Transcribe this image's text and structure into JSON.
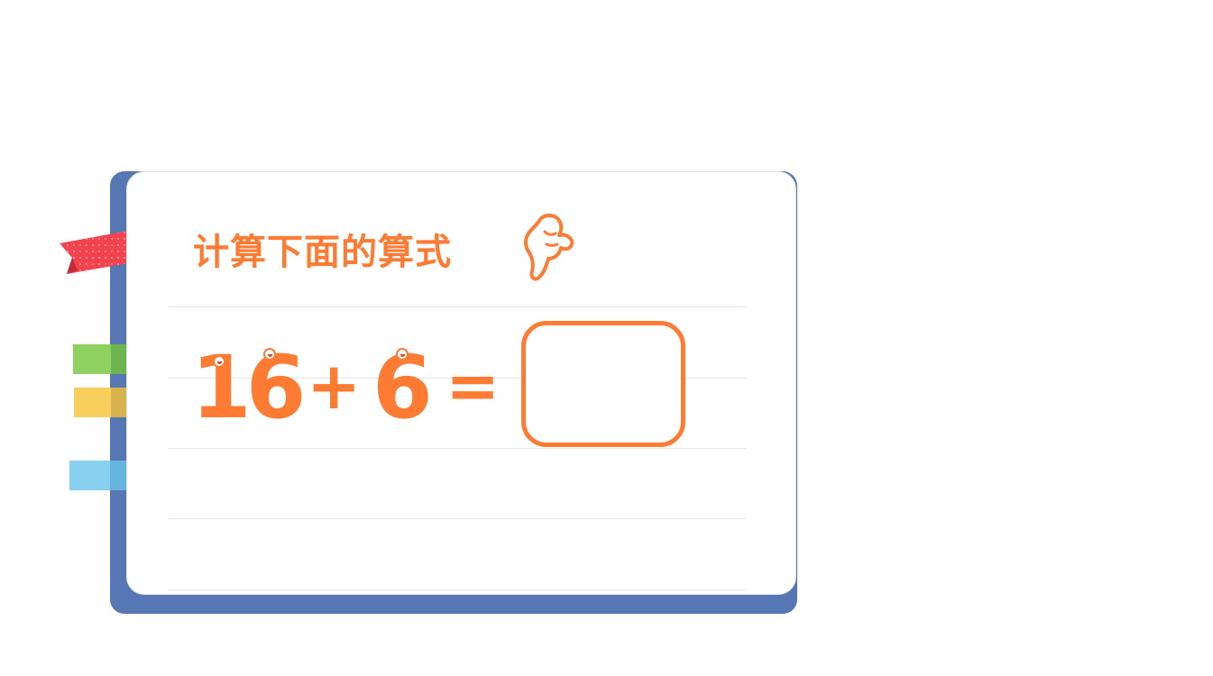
{
  "question": {
    "title": "计算下面的算式",
    "operand_a": "16",
    "operator": "+",
    "operand_b": "6",
    "equals": "=",
    "answer": ""
  },
  "icons": {
    "pointer": "pointing-hand-icon",
    "ribbon": "ribbon-bookmark"
  },
  "colors": {
    "accent": "#fd7b33",
    "book_cover": "#5677b3",
    "ribbon": "#f2434f",
    "tab_green": "#8fd160",
    "tab_yellow": "#f7cf5c",
    "tab_blue": "#87d0f0"
  }
}
